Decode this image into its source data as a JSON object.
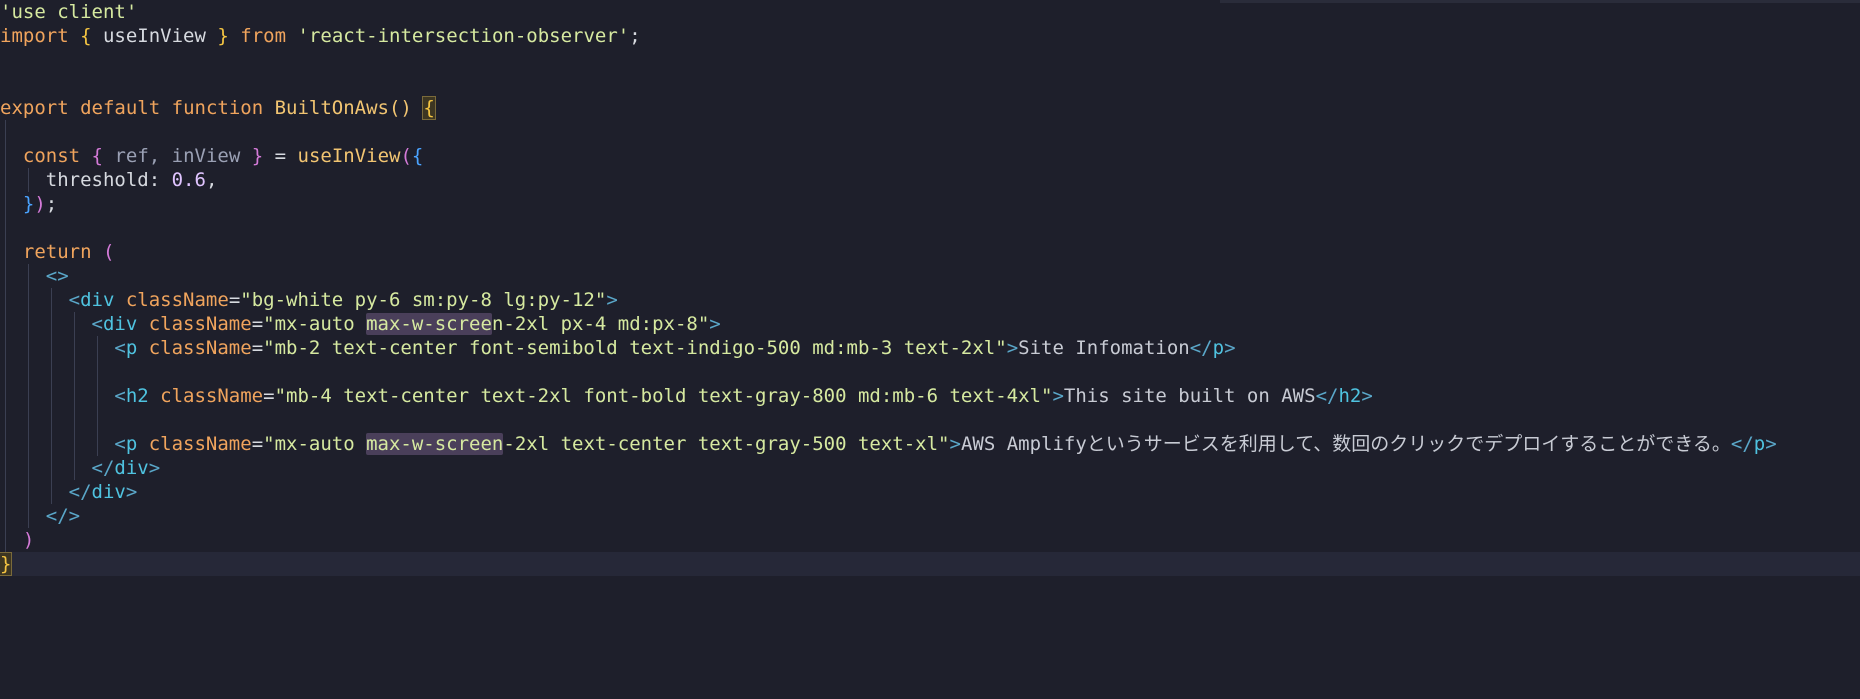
{
  "editor": {
    "colors": {
      "background": "#1e1f2b",
      "keyword": "#f0a45d",
      "string": "#d6e9a0",
      "function": "#f2c572",
      "variable": "#9aa0b4",
      "plain": "#d7dae0",
      "number": "#e0c4ff",
      "bracket_gold": "#f5c542",
      "bracket_purple": "#d47ad8",
      "bracket_blue": "#4aa3ff",
      "tag_bracket": "#5aa7c9",
      "tag_name": "#4fc3e0",
      "attr": "#f0a45d",
      "jsx_text": "#c8cbd4"
    },
    "lines": [
      {
        "tokens": [
          {
            "t": "'use client'",
            "c": "string"
          }
        ]
      },
      {
        "tokens": [
          {
            "t": "import",
            "c": "keyword"
          },
          {
            "t": " ",
            "c": "plain"
          },
          {
            "t": "{",
            "c": "bracket_gold"
          },
          {
            "t": " useInView ",
            "c": "plain"
          },
          {
            "t": "}",
            "c": "bracket_gold"
          },
          {
            "t": " ",
            "c": "plain"
          },
          {
            "t": "from",
            "c": "keyword"
          },
          {
            "t": " ",
            "c": "plain"
          },
          {
            "t": "'react-intersection-observer'",
            "c": "string"
          },
          {
            "t": ";",
            "c": "plain"
          }
        ]
      },
      {
        "tokens": []
      },
      {
        "tokens": []
      },
      {
        "tokens": [
          {
            "t": "export",
            "c": "keyword"
          },
          {
            "t": " ",
            "c": "plain"
          },
          {
            "t": "default",
            "c": "keyword"
          },
          {
            "t": " ",
            "c": "plain"
          },
          {
            "t": "function",
            "c": "keyword"
          },
          {
            "t": " ",
            "c": "plain"
          },
          {
            "t": "BuiltOnAws",
            "c": "function"
          },
          {
            "t": "()",
            "c": "function"
          },
          {
            "t": " ",
            "c": "plain"
          },
          {
            "t": "{",
            "c": "bracket_gold",
            "box": true
          }
        ]
      },
      {
        "tokens": []
      },
      {
        "tokens": [
          {
            "t": "  ",
            "c": "plain"
          },
          {
            "t": "const",
            "c": "keyword"
          },
          {
            "t": " ",
            "c": "plain"
          },
          {
            "t": "{",
            "c": "bracket_purple"
          },
          {
            "t": " ref, inView ",
            "c": "variable"
          },
          {
            "t": "}",
            "c": "bracket_purple"
          },
          {
            "t": " = ",
            "c": "plain"
          },
          {
            "t": "useInView",
            "c": "function"
          },
          {
            "t": "(",
            "c": "bracket_purple"
          },
          {
            "t": "{",
            "c": "bracket_blue"
          }
        ]
      },
      {
        "tokens": [
          {
            "t": "    threshold",
            "c": "plain"
          },
          {
            "t": ": ",
            "c": "plain"
          },
          {
            "t": "0.6",
            "c": "number"
          },
          {
            "t": ",",
            "c": "plain"
          }
        ]
      },
      {
        "tokens": [
          {
            "t": "  ",
            "c": "plain"
          },
          {
            "t": "}",
            "c": "bracket_blue"
          },
          {
            "t": ")",
            "c": "bracket_purple"
          },
          {
            "t": ";",
            "c": "plain"
          }
        ]
      },
      {
        "tokens": []
      },
      {
        "tokens": [
          {
            "t": "  ",
            "c": "plain"
          },
          {
            "t": "return",
            "c": "keyword"
          },
          {
            "t": " ",
            "c": "plain"
          },
          {
            "t": "(",
            "c": "bracket_purple"
          }
        ]
      },
      {
        "tokens": [
          {
            "t": "    ",
            "c": "plain"
          },
          {
            "t": "<>",
            "c": "tag_bracket"
          }
        ]
      },
      {
        "tokens": [
          {
            "t": "      ",
            "c": "plain"
          },
          {
            "t": "<",
            "c": "tag_bracket"
          },
          {
            "t": "div",
            "c": "tag_name"
          },
          {
            "t": " className",
            "c": "attr"
          },
          {
            "t": "=",
            "c": "plain"
          },
          {
            "t": "\"bg-white py-6 sm:py-8 lg:py-12\"",
            "c": "string"
          },
          {
            "t": ">",
            "c": "tag_bracket"
          }
        ]
      },
      {
        "tokens": [
          {
            "t": "        ",
            "c": "plain"
          },
          {
            "t": "<",
            "c": "tag_bracket"
          },
          {
            "t": "div",
            "c": "tag_name"
          },
          {
            "t": " className",
            "c": "attr"
          },
          {
            "t": "=",
            "c": "plain"
          },
          {
            "t": "\"mx-auto ",
            "c": "string"
          },
          {
            "t": "max-w-scree",
            "c": "string",
            "hl": true
          },
          {
            "t": "n-2xl px-4 md:px-8\"",
            "c": "string"
          },
          {
            "t": ">",
            "c": "tag_bracket"
          }
        ]
      },
      {
        "tokens": [
          {
            "t": "          ",
            "c": "plain"
          },
          {
            "t": "<",
            "c": "tag_bracket"
          },
          {
            "t": "p",
            "c": "tag_name"
          },
          {
            "t": " className",
            "c": "attr"
          },
          {
            "t": "=",
            "c": "plain"
          },
          {
            "t": "\"mb-2 text-center font-semibold text-indigo-500 md:mb-3 text-2xl\"",
            "c": "string"
          },
          {
            "t": ">",
            "c": "tag_bracket"
          },
          {
            "t": "Site Infomation",
            "c": "jsx_text"
          },
          {
            "t": "</",
            "c": "tag_bracket"
          },
          {
            "t": "p",
            "c": "tag_name"
          },
          {
            "t": ">",
            "c": "tag_bracket"
          }
        ]
      },
      {
        "tokens": []
      },
      {
        "tokens": [
          {
            "t": "          ",
            "c": "plain"
          },
          {
            "t": "<",
            "c": "tag_bracket"
          },
          {
            "t": "h2",
            "c": "tag_name"
          },
          {
            "t": " className",
            "c": "attr"
          },
          {
            "t": "=",
            "c": "plain"
          },
          {
            "t": "\"mb-4 text-center text-2xl font-bold text-gray-800 md:mb-6 text-4xl\"",
            "c": "string"
          },
          {
            "t": ">",
            "c": "tag_bracket"
          },
          {
            "t": "This site built on AWS",
            "c": "jsx_text"
          },
          {
            "t": "</",
            "c": "tag_bracket"
          },
          {
            "t": "h2",
            "c": "tag_name"
          },
          {
            "t": ">",
            "c": "tag_bracket"
          }
        ]
      },
      {
        "tokens": []
      },
      {
        "tokens": [
          {
            "t": "          ",
            "c": "plain"
          },
          {
            "t": "<",
            "c": "tag_bracket"
          },
          {
            "t": "p",
            "c": "tag_name"
          },
          {
            "t": " className",
            "c": "attr"
          },
          {
            "t": "=",
            "c": "plain"
          },
          {
            "t": "\"mx-auto ",
            "c": "string"
          },
          {
            "t": "max-w-screen",
            "c": "string",
            "hl": true
          },
          {
            "t": "-2xl text-center text-gray-500 text-xl\"",
            "c": "string"
          },
          {
            "t": ">",
            "c": "tag_bracket"
          },
          {
            "t": "AWS Amplifyというサービスを利用して、数回のクリックでデプロイすることができる。",
            "c": "jsx_text"
          },
          {
            "t": "</",
            "c": "tag_bracket"
          },
          {
            "t": "p",
            "c": "tag_name"
          },
          {
            "t": ">",
            "c": "tag_bracket"
          }
        ]
      },
      {
        "tokens": [
          {
            "t": "        ",
            "c": "plain"
          },
          {
            "t": "</",
            "c": "tag_bracket"
          },
          {
            "t": "div",
            "c": "tag_name"
          },
          {
            "t": ">",
            "c": "tag_bracket"
          }
        ]
      },
      {
        "tokens": [
          {
            "t": "      ",
            "c": "plain"
          },
          {
            "t": "</",
            "c": "tag_bracket"
          },
          {
            "t": "div",
            "c": "tag_name"
          },
          {
            "t": ">",
            "c": "tag_bracket"
          }
        ]
      },
      {
        "tokens": [
          {
            "t": "    ",
            "c": "plain"
          },
          {
            "t": "</>",
            "c": "tag_bracket"
          }
        ]
      },
      {
        "tokens": [
          {
            "t": "  ",
            "c": "plain"
          },
          {
            "t": ")",
            "c": "bracket_purple"
          }
        ]
      },
      {
        "tokens": [
          {
            "t": "}",
            "c": "bracket_gold",
            "box": true
          }
        ]
      }
    ]
  }
}
